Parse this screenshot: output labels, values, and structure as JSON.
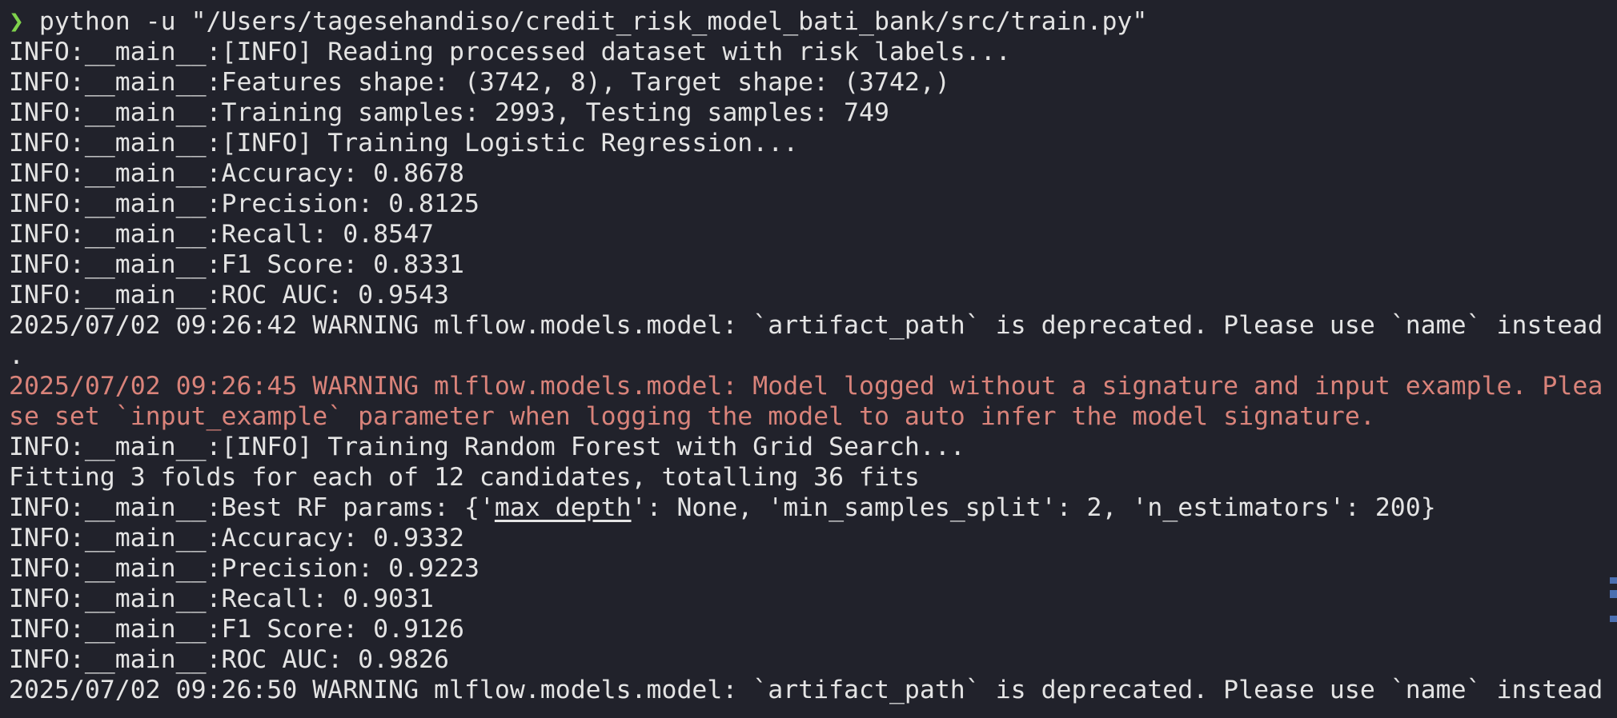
{
  "terminal": {
    "prompt_symbol": "❯",
    "command": " python -u \"/Users/tagesehandiso/credit_risk_model_bati_bank/src/train.py\"",
    "lines": [
      "INFO:__main__:[INFO] Reading processed dataset with risk labels...",
      "INFO:__main__:Features shape: (3742, 8), Target shape: (3742,)",
      "INFO:__main__:Training samples: 2993, Testing samples: 749",
      "INFO:__main__:[INFO] Training Logistic Regression...",
      "INFO:__main__:Accuracy: 0.8678",
      "INFO:__main__:Precision: 0.8125",
      "INFO:__main__:Recall: 0.8547",
      "INFO:__main__:F1 Score: 0.8331",
      "INFO:__main__:ROC AUC: 0.9543",
      "2025/07/02 09:26:42 WARNING mlflow.models.model: `artifact_path` is deprecated. Please use `name` instead",
      "."
    ],
    "warning_red_lines": [
      "2025/07/02 09:26:45 WARNING mlflow.models.model: Model logged without a signature and input example. Plea",
      "se set `input_example` parameter when logging the model to auto infer the model signature."
    ],
    "lines_after": [
      "INFO:__main__:[INFO] Training Random Forest with Grid Search...",
      "Fitting 3 folds for each of 12 candidates, totalling 36 fits"
    ],
    "best_params": {
      "prefix": "INFO:__main__:Best RF params: {'",
      "underlined": "max_depth",
      "suffix": "': None, 'min_samples_split': 2, 'n_estimators': 200}"
    },
    "lines_end": [
      "INFO:__main__:Accuracy: 0.9332",
      "INFO:__main__:Precision: 0.9223",
      "INFO:__main__:Recall: 0.9031",
      "INFO:__main__:F1 Score: 0.9126",
      "INFO:__main__:ROC AUC: 0.9826",
      "2025/07/02 09:26:50 WARNING mlflow.models.model: `artifact_path` is deprecated. Please use `name` instead"
    ]
  },
  "colors": {
    "background": "#21222b",
    "text": "#e4e4e4",
    "warning_red": "#d9837a",
    "prompt_green": "#7fd24c",
    "scroll_marker": "#4b6fb0"
  }
}
